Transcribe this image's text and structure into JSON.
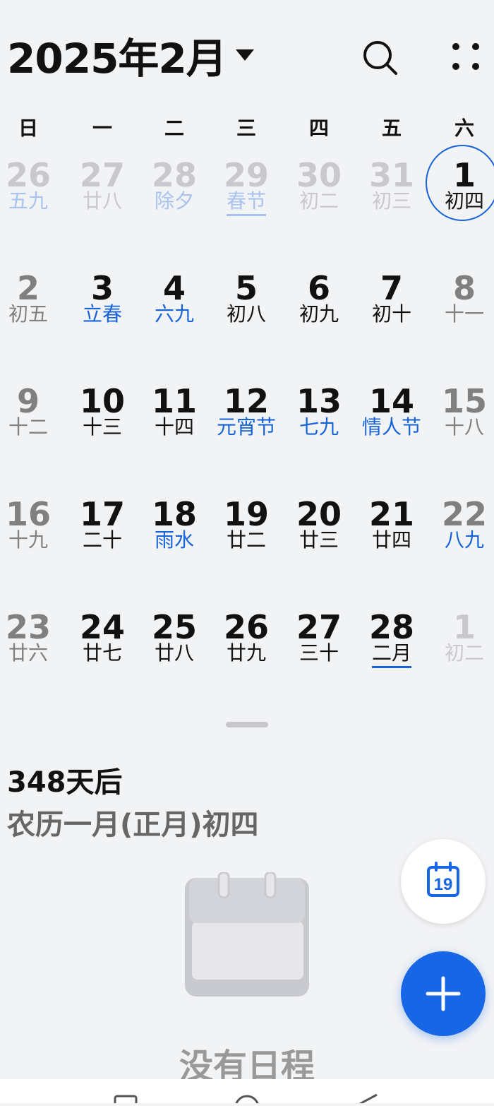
{
  "header": {
    "title": "2025年2月"
  },
  "weekdays": [
    "日",
    "一",
    "二",
    "三",
    "四",
    "五",
    "六"
  ],
  "weeks": [
    [
      {
        "d": "26",
        "l": "五九",
        "s": "dim",
        "lc": "lightblue"
      },
      {
        "d": "27",
        "l": "廿八",
        "s": "dim"
      },
      {
        "d": "28",
        "l": "除夕",
        "s": "dim",
        "lc": "lightblue"
      },
      {
        "d": "29",
        "l": "春节",
        "s": "dim",
        "lc": "lightblue",
        "ul": "light"
      },
      {
        "d": "30",
        "l": "初二",
        "s": "dim"
      },
      {
        "d": "31",
        "l": "初三",
        "s": "dim"
      },
      {
        "d": "1",
        "l": "初四",
        "s": "today"
      }
    ],
    [
      {
        "d": "2",
        "l": "初五",
        "s": "gray"
      },
      {
        "d": "3",
        "l": "立春",
        "lc": "blue"
      },
      {
        "d": "4",
        "l": "六九",
        "lc": "blue"
      },
      {
        "d": "5",
        "l": "初八"
      },
      {
        "d": "6",
        "l": "初九"
      },
      {
        "d": "7",
        "l": "初十"
      },
      {
        "d": "8",
        "l": "十一",
        "s": "gray"
      }
    ],
    [
      {
        "d": "9",
        "l": "十二",
        "s": "gray"
      },
      {
        "d": "10",
        "l": "十三"
      },
      {
        "d": "11",
        "l": "十四"
      },
      {
        "d": "12",
        "l": "元宵节",
        "lc": "blue"
      },
      {
        "d": "13",
        "l": "七九",
        "lc": "blue"
      },
      {
        "d": "14",
        "l": "情人节",
        "lc": "blue"
      },
      {
        "d": "15",
        "l": "十八",
        "s": "gray"
      }
    ],
    [
      {
        "d": "16",
        "l": "十九",
        "s": "gray"
      },
      {
        "d": "17",
        "l": "二十"
      },
      {
        "d": "18",
        "l": "雨水",
        "lc": "blue"
      },
      {
        "d": "19",
        "l": "廿二"
      },
      {
        "d": "20",
        "l": "廿三"
      },
      {
        "d": "21",
        "l": "廿四"
      },
      {
        "d": "22",
        "l": "八九",
        "s": "gray",
        "lc": "blue"
      }
    ],
    [
      {
        "d": "23",
        "l": "廿六",
        "s": "gray"
      },
      {
        "d": "24",
        "l": "廿七"
      },
      {
        "d": "25",
        "l": "廿八"
      },
      {
        "d": "26",
        "l": "廿九"
      },
      {
        "d": "27",
        "l": "三十"
      },
      {
        "d": "28",
        "l": "二月",
        "ul": "dark"
      },
      {
        "d": "1",
        "l": "初二",
        "s": "dim"
      }
    ]
  ],
  "details": {
    "countdown": "348天后",
    "lunar": "农历一月(正月)初四"
  },
  "empty": {
    "label": "没有日程"
  },
  "fab": {
    "today_number": "19"
  },
  "colors": {
    "accent": "#1766e6",
    "holiday": "#1763d8",
    "background": "#f2f3f5"
  }
}
